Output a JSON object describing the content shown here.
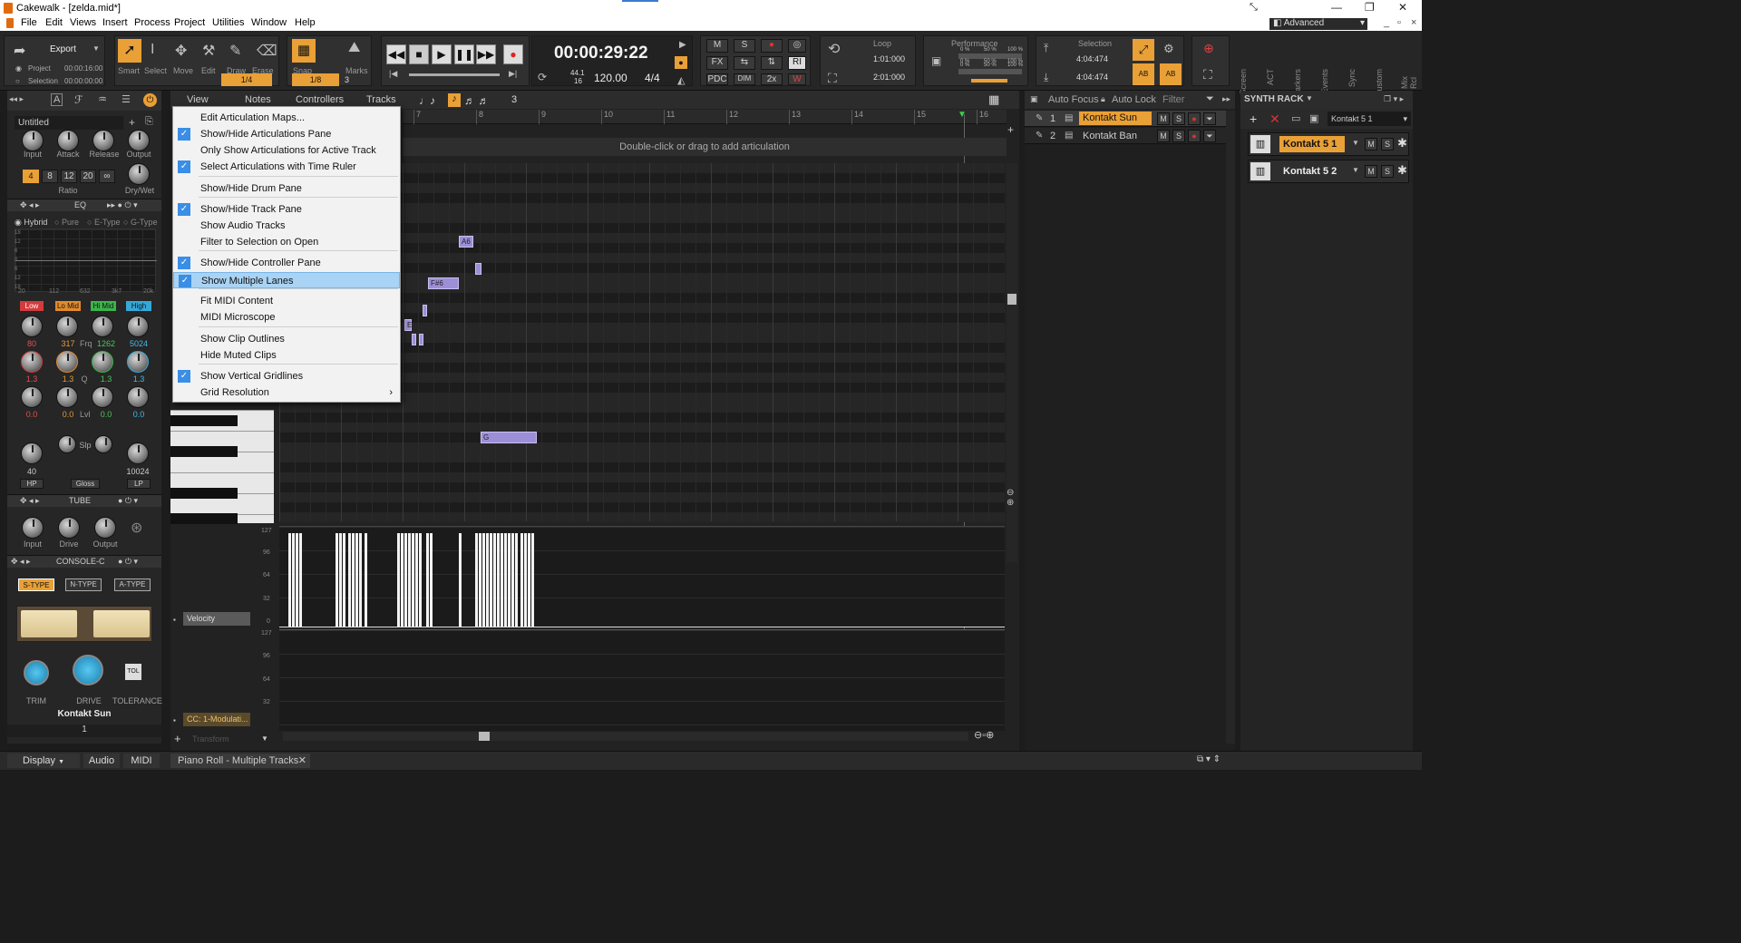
{
  "window": {
    "title": "Cakewalk - [zelda.mid*]",
    "preset": "Advanced"
  },
  "menu": [
    "File",
    "Edit",
    "Views",
    "Insert",
    "Process",
    "Project",
    "Utilities",
    "Window",
    "Help"
  ],
  "control_bar": {
    "export_label": "Export",
    "project_label": "Project",
    "project_time": "00:00:16:00",
    "selection_label": "Selection",
    "selection_time": "00:00:00:00",
    "tools": [
      "Smart",
      "Select",
      "Move",
      "Edit",
      "Draw",
      "Erase"
    ],
    "snap_label": "Snap",
    "marks_label": "Marks",
    "snap_value": "1/4",
    "snap_sub": "1/8",
    "snap_num": "3",
    "time": "00:00:29:22",
    "sample_rate": "44.1",
    "bit_depth": "16",
    "tempo": "120.00",
    "meter": "4/4",
    "mix_buttons": [
      "M",
      "S",
      "FX",
      "PDC",
      "DIM",
      "2x",
      "RI"
    ],
    "loop_label": "Loop",
    "loop_start": "1:01:000",
    "loop_end": "2:01:000",
    "performance_label": "Performance",
    "perf_vals": [
      "0 %",
      "50 %",
      "100 %"
    ],
    "selection_panel_label": "Selection",
    "sel_start": "4:04:474",
    "sel_end": "4:04:474",
    "side_tabs": [
      "Screen",
      "ACT",
      "Markers",
      "Events",
      "Sync",
      "Custom",
      "Mix Rcl"
    ]
  },
  "inspector": {
    "preset": "Untitled",
    "comp_labels": [
      "Input",
      "Attack",
      "Release",
      "Output"
    ],
    "ratio_buttons": [
      "4",
      "8",
      "12",
      "20",
      "∞"
    ],
    "ratio_label": "Ratio",
    "drywet_label": "Dry/Wet",
    "eq_label": "EQ",
    "eq_modes": [
      "Hybrid",
      "Pure",
      "E-Type",
      "G-Type"
    ],
    "eq_y": [
      "18",
      "12",
      "6",
      "0",
      "6",
      "12",
      "18"
    ],
    "eq_x": [
      "20",
      "112",
      "632",
      "3k7",
      "20k"
    ],
    "bands": [
      "Low",
      "Lo Mid",
      "Hi Mid",
      "High"
    ],
    "freq": [
      "80",
      "317",
      "1262",
      "5024"
    ],
    "q": [
      "1.3",
      "1.3",
      "1.3",
      "1.3"
    ],
    "gain": [
      "0.0",
      "0.0",
      "0.0",
      "0.0"
    ],
    "mid_labels": [
      "Frq",
      "Q",
      "Lvl"
    ],
    "hp": "40",
    "lp": "10024",
    "hp_label": "HP",
    "lp_label": "LP",
    "gloss_label": "Gloss",
    "slp_label": "Slp",
    "tube_label": "TUBE",
    "tube_knobs": [
      "Input",
      "Drive",
      "Output"
    ],
    "console_label": "CONSOLE-C",
    "console_types": [
      "S-TYPE",
      "N-TYPE",
      "A-TYPE"
    ],
    "console_knobs": [
      "TRIM",
      "DRIVE",
      "TOLERANCE"
    ],
    "tol_label": "TOL",
    "track_name": "Kontakt Sun",
    "track_num": "1"
  },
  "piano_roll": {
    "menus": [
      "View",
      "Notes",
      "Controllers",
      "Tracks"
    ],
    "ruler": [
      "7",
      "8",
      "9",
      "10",
      "11",
      "12",
      "13",
      "14",
      "15",
      "16"
    ],
    "articulation_hint": "Double-click or drag to add articulation",
    "note_labels": [
      "A6",
      "F#6",
      "E",
      "G"
    ],
    "vel_scale": [
      "127",
      "96",
      "64",
      "32",
      "0"
    ],
    "cc_scale": [
      "127",
      "96",
      "64",
      "32",
      "0"
    ],
    "velocity_label": "Velocity",
    "cc_label": "CC: 1-Modulati...",
    "tab_label": "Piano Roll - Multiple Tracks"
  },
  "dropdown": [
    {
      "label": "Edit Articulation Maps...",
      "checked": false
    },
    {
      "label": "Show/Hide Articulations Pane",
      "checked": true
    },
    {
      "label": "Only Show Articulations for Active Track",
      "checked": false
    },
    {
      "label": "Select Articulations with Time Ruler",
      "checked": true
    },
    {
      "label": "Show/Hide Drum Pane",
      "checked": false
    },
    {
      "label": "Show/Hide Track Pane",
      "checked": true
    },
    {
      "label": "Show Audio Tracks",
      "checked": false
    },
    {
      "label": "Filter to Selection on Open",
      "checked": false
    },
    {
      "label": "Show/Hide Controller Pane",
      "checked": true
    },
    {
      "label": "Show Multiple Lanes",
      "checked": true,
      "highlighted": true
    },
    {
      "label": "Fit MIDI Content",
      "checked": false
    },
    {
      "label": "MIDI Microscope",
      "checked": false
    },
    {
      "label": "Show Clip Outlines",
      "checked": false
    },
    {
      "label": "Hide Muted Clips",
      "checked": false
    },
    {
      "label": "Show Vertical Gridlines",
      "checked": true
    },
    {
      "label": "Grid Resolution",
      "checked": false,
      "submenu": "›"
    }
  ],
  "track_pane": {
    "auto_focus": "Auto Focus",
    "auto_lock": "Auto Lock",
    "filter": "Filter",
    "tracks": [
      {
        "num": "1",
        "name": "Kontakt Sun"
      },
      {
        "num": "2",
        "name": "Kontakt Ban"
      }
    ],
    "ms": [
      "M",
      "S"
    ]
  },
  "synth_rack": {
    "title": "SYNTH RACK",
    "selected": "Kontakt 5 1",
    "items": [
      "Kontakt 5 1",
      "Kontakt 5 2"
    ],
    "ms": [
      "M",
      "S"
    ]
  },
  "bottom_tabs": [
    "Display",
    "Audio",
    "MIDI"
  ],
  "colors": {
    "accent": "#e9a036",
    "note": "#9d8fd6",
    "highlight": "#a9d3f4",
    "check": "#3a8ee6"
  }
}
